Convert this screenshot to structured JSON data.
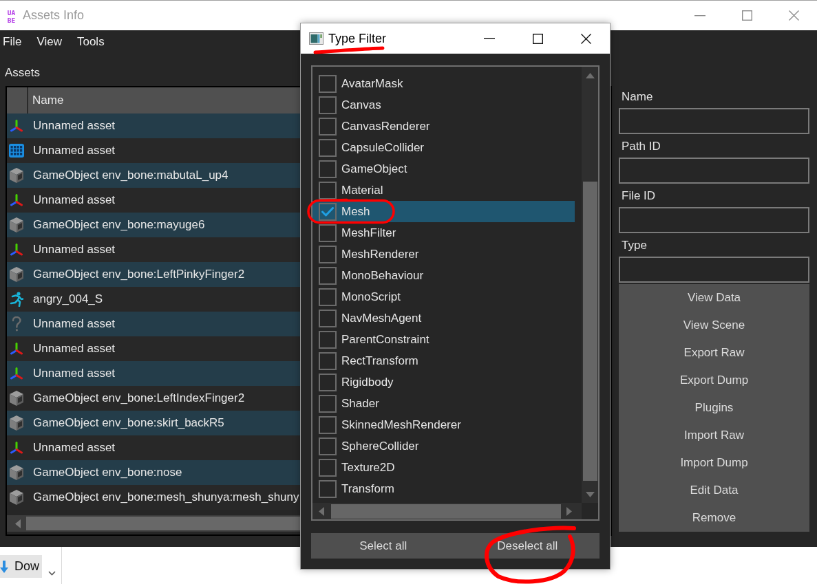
{
  "window": {
    "logo": [
      "UA",
      "BE"
    ],
    "title": "Assets Info"
  },
  "menu": [
    "File",
    "View",
    "Tools"
  ],
  "assets_panel": {
    "label": "Assets",
    "columns": [
      "Name"
    ],
    "rows": [
      {
        "kind": "axes",
        "name": "Unnamed asset"
      },
      {
        "kind": "grid",
        "name": "Unnamed asset"
      },
      {
        "kind": "cube",
        "name": "GameObject env_bone:mabutaL_up4"
      },
      {
        "kind": "axes",
        "name": "Unnamed asset"
      },
      {
        "kind": "cube",
        "name": "GameObject env_bone:mayuge6"
      },
      {
        "kind": "axes",
        "name": "Unnamed asset"
      },
      {
        "kind": "cube",
        "name": "GameObject env_bone:LeftPinkyFinger2"
      },
      {
        "kind": "runner",
        "name": "angry_004_S"
      },
      {
        "kind": "question",
        "name": "Unnamed asset"
      },
      {
        "kind": "axes",
        "name": "Unnamed asset"
      },
      {
        "kind": "axes",
        "name": "Unnamed asset"
      },
      {
        "kind": "cube",
        "name": "GameObject env_bone:LeftIndexFinger2"
      },
      {
        "kind": "cube",
        "name": "GameObject env_bone:skirt_backR5"
      },
      {
        "kind": "axes",
        "name": "Unnamed asset"
      },
      {
        "kind": "cube",
        "name": "GameObject env_bone:nose"
      },
      {
        "kind": "cube",
        "name": "GameObject env_bone:mesh_shunya:mesh_shuny"
      }
    ]
  },
  "details": {
    "fields": [
      {
        "label": "Name"
      },
      {
        "label": "Path ID"
      },
      {
        "label": "File ID"
      },
      {
        "label": "Type"
      }
    ],
    "buttons": [
      "View Data",
      "View Scene",
      "Export Raw",
      "Export Dump",
      "Plugins",
      "Import Raw",
      "Import Dump",
      "Edit Data",
      "Remove"
    ]
  },
  "type_filter": {
    "title": "Type Filter",
    "items": [
      {
        "label": "AvatarMask",
        "checked": false,
        "selected": false
      },
      {
        "label": "Canvas",
        "checked": false,
        "selected": false
      },
      {
        "label": "CanvasRenderer",
        "checked": false,
        "selected": false
      },
      {
        "label": "CapsuleCollider",
        "checked": false,
        "selected": false
      },
      {
        "label": "GameObject",
        "checked": false,
        "selected": false
      },
      {
        "label": "Material",
        "checked": false,
        "selected": false
      },
      {
        "label": "Mesh",
        "checked": true,
        "selected": true
      },
      {
        "label": "MeshFilter",
        "checked": false,
        "selected": false
      },
      {
        "label": "MeshRenderer",
        "checked": false,
        "selected": false
      },
      {
        "label": "MonoBehaviour",
        "checked": false,
        "selected": false
      },
      {
        "label": "MonoScript",
        "checked": false,
        "selected": false
      },
      {
        "label": "NavMeshAgent",
        "checked": false,
        "selected": false
      },
      {
        "label": "ParentConstraint",
        "checked": false,
        "selected": false
      },
      {
        "label": "RectTransform",
        "checked": false,
        "selected": false
      },
      {
        "label": "Rigidbody",
        "checked": false,
        "selected": false
      },
      {
        "label": "Shader",
        "checked": false,
        "selected": false
      },
      {
        "label": "SkinnedMeshRenderer",
        "checked": false,
        "selected": false
      },
      {
        "label": "SphereCollider",
        "checked": false,
        "selected": false
      },
      {
        "label": "Texture2D",
        "checked": false,
        "selected": false
      },
      {
        "label": "Transform",
        "checked": false,
        "selected": false
      }
    ],
    "buttons": [
      "Select all",
      "Deselect all"
    ]
  },
  "background_window": {
    "nav_item": "Dow"
  }
}
